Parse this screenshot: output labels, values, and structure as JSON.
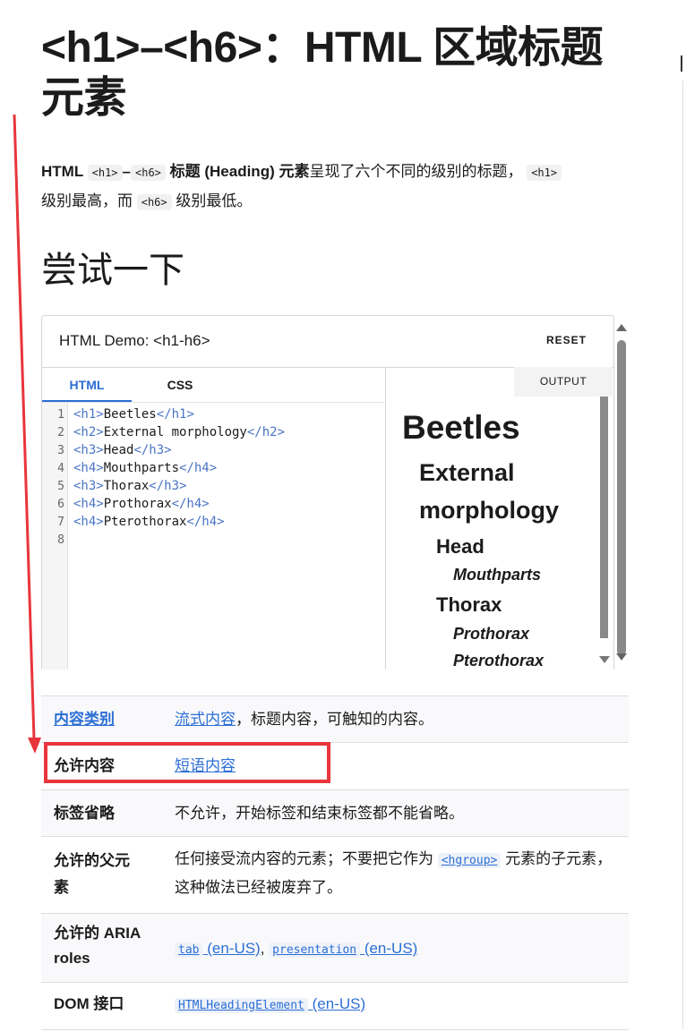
{
  "title": "<h1>–<h6>：HTML 区域标题元素",
  "intro": {
    "p1": "HTML ",
    "code1": "<h1>",
    "dash": "–",
    "code2": "<h6>",
    "bold": " 标题 (Heading) 元素",
    "p2": "呈现了六个不同的级别的标题，",
    "code3": "<h1>",
    "p3": "级别最高，而 ",
    "code4": "<h6>",
    "p4": " 级别最低。"
  },
  "section_title": "尝试一下",
  "demo": {
    "title": "HTML Demo: <h1-h6>",
    "reset": "RESET",
    "tabs": [
      "HTML",
      "CSS"
    ],
    "output_tab": "OUTPUT",
    "code_lines": [
      {
        "n": "1",
        "open": "<h1>",
        "text": "Beetles",
        "close": "</h1>"
      },
      {
        "n": "2",
        "open": "<h2>",
        "text": "External morphology",
        "close": "</h2>"
      },
      {
        "n": "3",
        "open": "<h3>",
        "text": "Head",
        "close": "</h3>"
      },
      {
        "n": "4",
        "open": "<h4>",
        "text": "Mouthparts",
        "close": "</h4>"
      },
      {
        "n": "5",
        "open": "<h3>",
        "text": "Thorax",
        "close": "</h3>"
      },
      {
        "n": "6",
        "open": "<h4>",
        "text": "Prothorax",
        "close": "</h4>"
      },
      {
        "n": "7",
        "open": "<h4>",
        "text": "Pterothorax",
        "close": "</h4>"
      },
      {
        "n": "8",
        "open": "",
        "text": "",
        "close": ""
      }
    ],
    "output": {
      "h1": "Beetles",
      "h2a": "External",
      "h2b": "morphology",
      "h3a": "Head",
      "h4a": "Mouthparts",
      "h3b": "Thorax",
      "h4b": "Prothorax",
      "h4c": "Pterothorax"
    }
  },
  "props": {
    "r1_label": "内容类别",
    "r1_link": "流式内容",
    "r1_rest": "，标题内容，可触知的内容。",
    "r2_label": "允许内容",
    "r2_link": "短语内容",
    "r3_label": "标签省略",
    "r3_value": "不允许，开始标签和结束标签都不能省略。",
    "r4_label": "允许的父元素",
    "r4_pre": "任何接受流内容的元素；不要把它作为 ",
    "r4_code": "<hgroup>",
    "r4_post": " 元素的子元素，这种做法已经被废弃了。",
    "r5_label": "允许的 ARIA roles",
    "r5_code1": "tab",
    "r5_en1": " (en-US)",
    "r5_sep": ", ",
    "r5_code2": "presentation",
    "r5_en2": " (en-US)",
    "r6_label": "DOM 接口",
    "r6_code": "HTMLHeadingElement",
    "r6_en": " (en-US)"
  },
  "colors": {
    "link": "#2c6ed5",
    "highlight": "#e8353c"
  }
}
